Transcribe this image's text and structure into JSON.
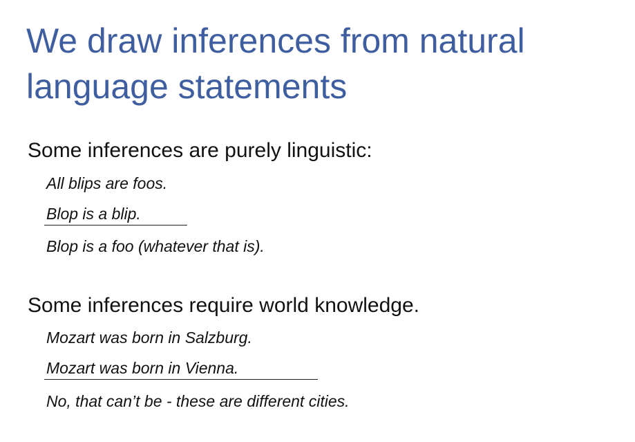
{
  "slide": {
    "title": "We draw inferences from natural language statements",
    "sections": [
      {
        "heading": "Some inferences are purely linguistic:",
        "premises": [
          "All blips are foos.",
          "Blop is a blip."
        ],
        "conclusion": "Blop is a foo (whatever that is)."
      },
      {
        "heading": "Some inferences require world knowledge.",
        "premises": [
          "Mozart was born in Salzburg.",
          "Mozart was born in Vienna."
        ],
        "conclusion": "No, that can’t be - these are different cities."
      }
    ]
  }
}
